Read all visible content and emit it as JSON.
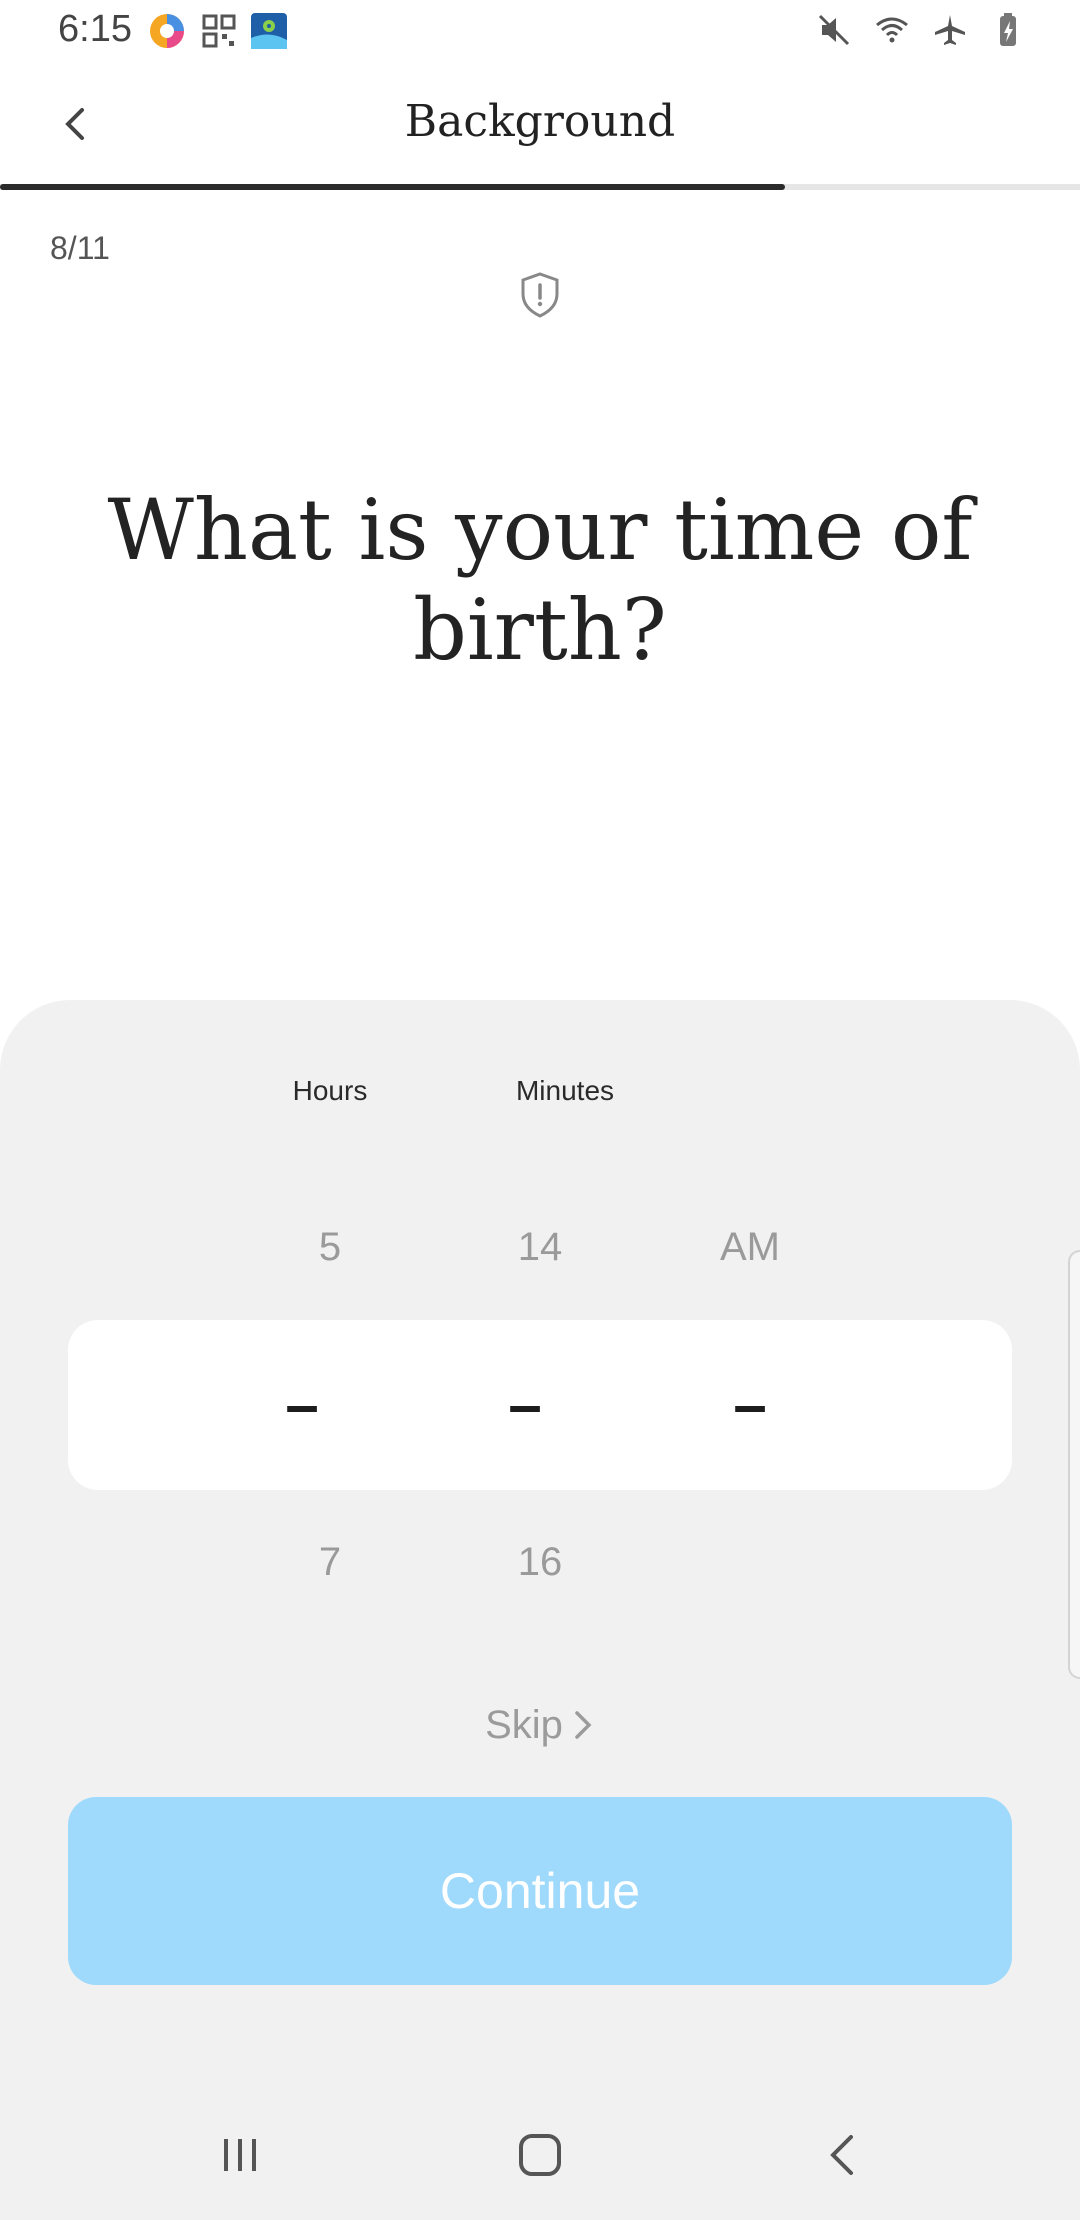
{
  "status_bar": {
    "time": "6:15",
    "icons": [
      "photo-app-icon",
      "qr-app-icon",
      "maps-app-icon",
      "mute-icon",
      "wifi-icon",
      "airplane-icon",
      "battery-icon"
    ]
  },
  "header": {
    "title": "Background",
    "progress_fraction": 0.727
  },
  "step": {
    "counter": "8/11"
  },
  "question": "What is your time of birth?",
  "picker": {
    "hours_label": "Hours",
    "minutes_label": "Minutes",
    "above": {
      "hours": "5",
      "minutes": "14",
      "period": "AM"
    },
    "selected": {
      "hours": "–",
      "minutes": "–",
      "period": "–"
    },
    "below": {
      "hours": "7",
      "minutes": "16"
    }
  },
  "actions": {
    "skip_label": "Skip",
    "continue_label": "Continue"
  },
  "colors": {
    "continue_bg": "#9fdafc",
    "sheet_bg": "#f1f1f1",
    "progress_fill": "#2b2b2b"
  }
}
